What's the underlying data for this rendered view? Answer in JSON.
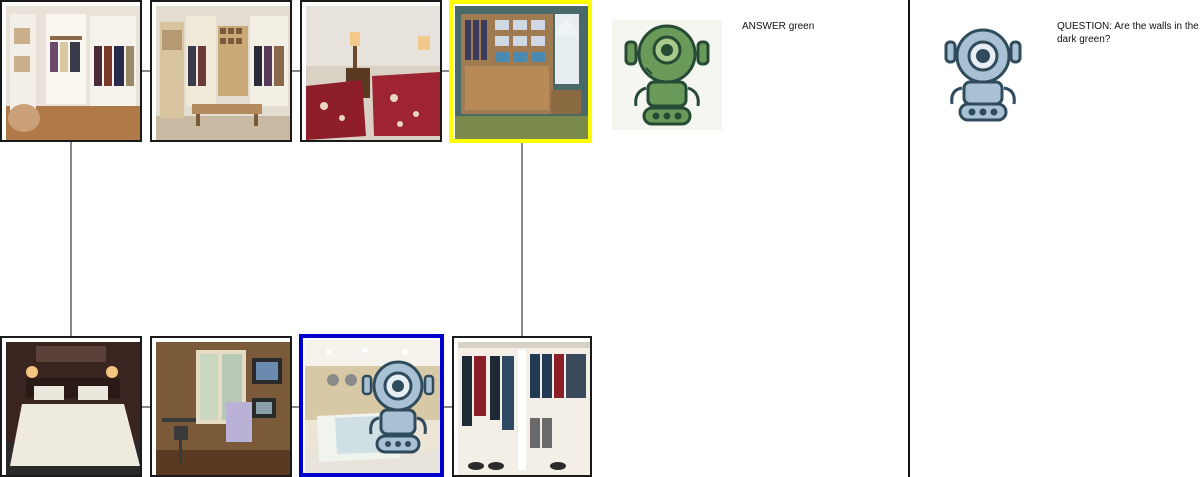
{
  "answer": {
    "prefix": "ANSWER",
    "value": "green"
  },
  "question": {
    "text": "QUESTION: Are the walls in the dark green?"
  },
  "colors": {
    "selected_primary": "#ffff00",
    "selected_secondary": "#0000cc",
    "answer_robot": "#6a9a5a",
    "question_robot": "#a9c1d4"
  },
  "icons": [
    "green-robot-icon",
    "blue-robot-icon"
  ]
}
